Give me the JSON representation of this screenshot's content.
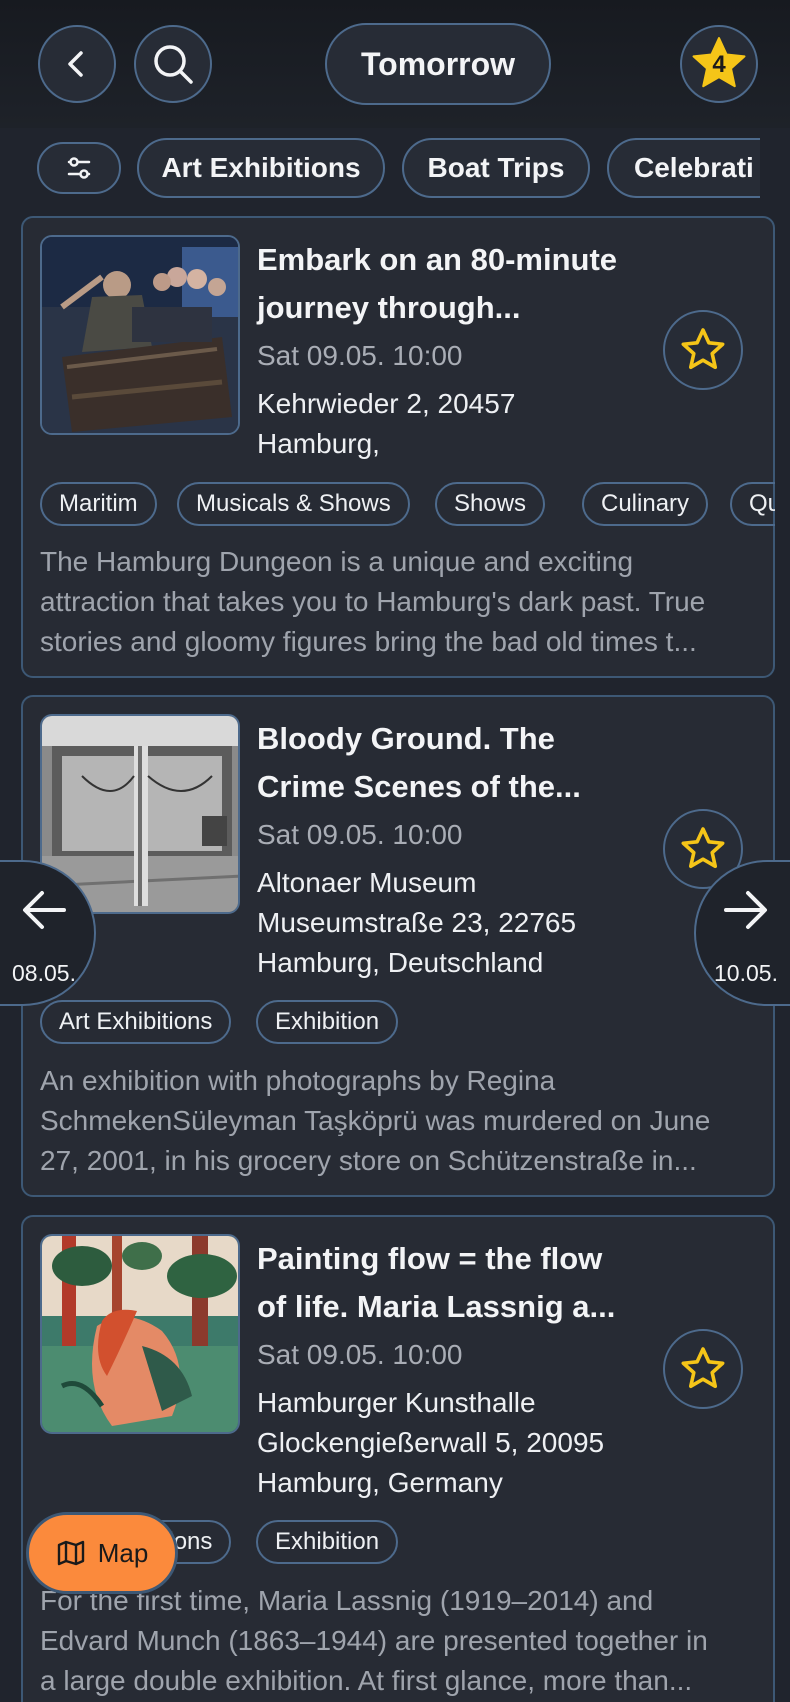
{
  "header": {
    "date_label": "Tomorrow",
    "favorites_count": "4",
    "accent_color": "#f5c518",
    "border_color": "#4d6a8c"
  },
  "filters": [
    "Art Exhibitions",
    "Boat Trips",
    "Celebrati"
  ],
  "events": [
    {
      "title": "Embark on an 80-minute journey through...",
      "title_line1": "Embark on an 80-minute",
      "title_line2": "journey through...",
      "when": "Sat 09.05. 10:00",
      "address_line1": "Kehrwieder 2, 20457",
      "address_line2": "Hamburg,",
      "tags": [
        "Maritim",
        "Musicals & Shows",
        "Shows",
        "Culinary",
        "Qu"
      ],
      "desc_line1": "The Hamburg Dungeon is a unique and exciting",
      "desc_line2": "attraction that takes you to Hamburg's dark past. True",
      "desc_line3": "stories and gloomy figures bring the bad old times t..."
    },
    {
      "title_line1": "Bloody Ground. The",
      "title_line2": "Crime Scenes of the...",
      "when": "Sat 09.05. 10:00",
      "address_line1": "Altonaer Museum",
      "address_line2": "Museumstraße 23, 22765",
      "address_line3": "Hamburg, Deutschland",
      "tags": [
        "Art Exhibitions",
        "Exhibition"
      ],
      "desc_line1": "An exhibition with photographs by Regina",
      "desc_line2": "SchmekenSüleyman Taşköprü was murdered on June",
      "desc_line3": "27, 2001, in his grocery store on Schützenstraße in..."
    },
    {
      "title_line1": "Painting flow = the flow",
      "title_line2": "of life. Maria Lassnig a...",
      "when": "Sat 09.05. 10:00",
      "address_line1": "Hamburger Kunsthalle",
      "address_line2": "Glockengießerwall 5, 20095",
      "address_line3": "Hamburg, Germany",
      "tags": [
        "Art Exhibitions",
        "Exhibition"
      ],
      "desc_line1": "For the first time, Maria Lassnig (1919–2014) and",
      "desc_line2": "Edvard Munch (1863–1944) are presented together in",
      "desc_line3": "a large double exhibition. At first glance, more than..."
    }
  ],
  "day_nav": {
    "prev_label": "08.05.",
    "next_label": "10.05."
  },
  "map_button": {
    "label": "Map",
    "color": "#fb8a3c"
  }
}
